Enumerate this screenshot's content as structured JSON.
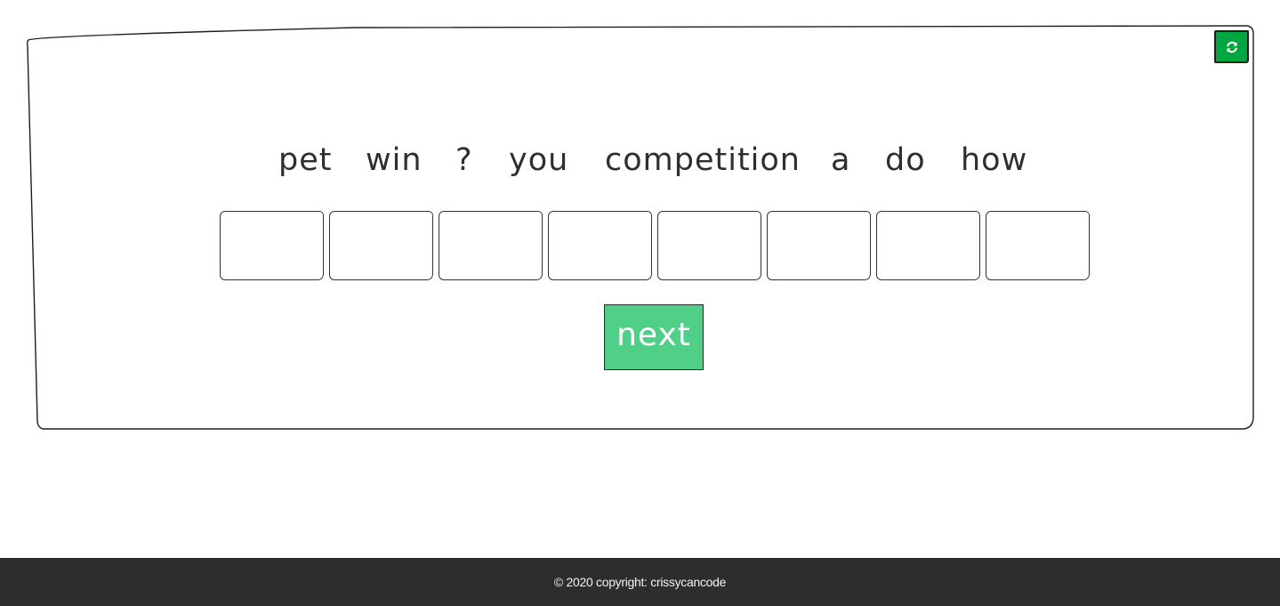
{
  "game": {
    "scrambled_words": [
      "pet",
      "win",
      "?",
      "you",
      "competition",
      "a",
      "do",
      "how"
    ],
    "answer_slots": [
      "",
      "",
      "",
      "",
      "",
      "",
      "",
      ""
    ],
    "next_label": "next",
    "refresh_icon": "refresh-icon"
  },
  "footer": {
    "copyright": "© 2020 copyright: crissycancode"
  },
  "colors": {
    "refresh_button": "#00a63f",
    "next_button": "#50cf88",
    "footer_background": "#2d2d2d",
    "ink": "#2e2e2e"
  }
}
